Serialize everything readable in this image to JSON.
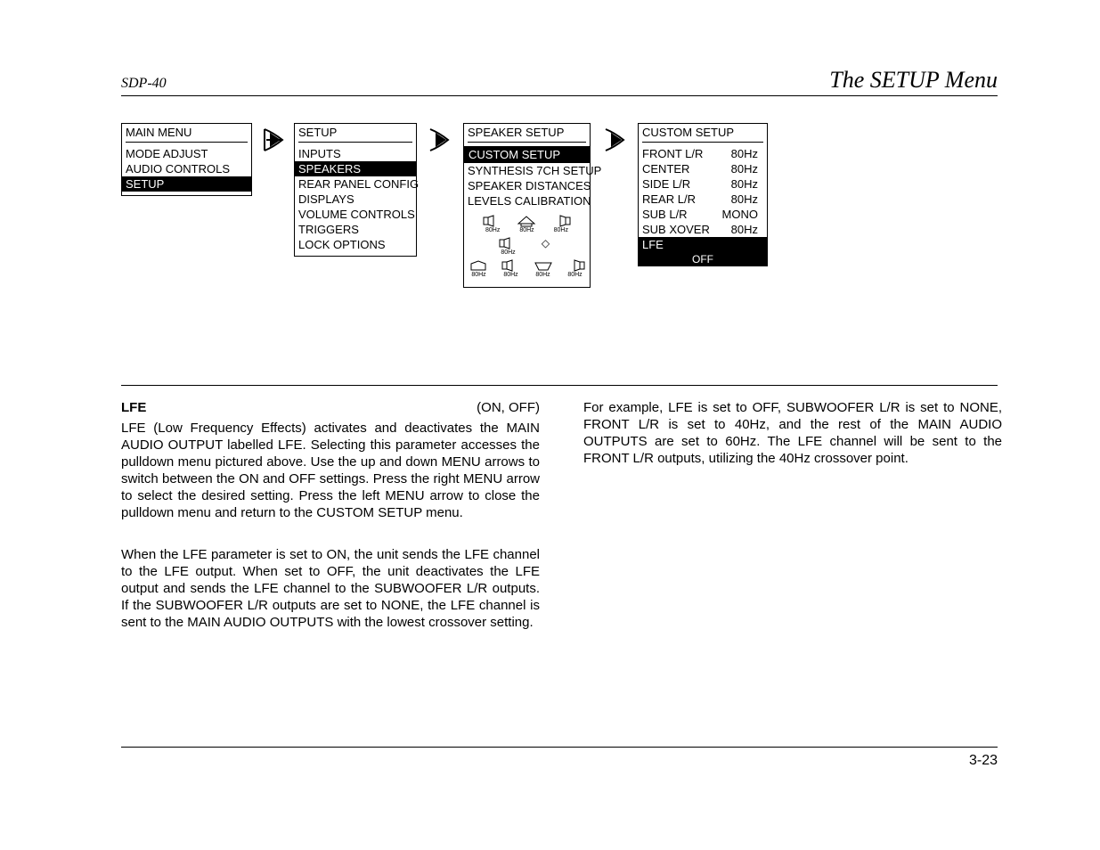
{
  "header": {
    "left": "SDP-40",
    "right": "The SETUP Menu"
  },
  "footer": {
    "page": "3-23"
  },
  "menus": {
    "main": {
      "title": "MAIN MENU",
      "items": [
        "MODE ADJUST",
        "AUDIO CONTROLS",
        "SETUP"
      ],
      "selected": 2
    },
    "setup": {
      "title": "SETUP",
      "items": [
        "INPUTS",
        "SPEAKERS",
        "REAR PANEL CONFIG",
        "DISPLAYS",
        "VOLUME CONTROLS",
        "TRIGGERS",
        "LOCK OPTIONS"
      ],
      "selected": 1
    },
    "speaker": {
      "title": "SPEAKER SETUP",
      "items": [
        "CUSTOM SETUP",
        "SYNTHESIS 7CH SETUP",
        "SPEAKER DISTANCES",
        "LEVELS CALIBRATION"
      ],
      "selected": 0,
      "diagram": {
        "row1": [
          {
            "label": "L",
            "sub": "80Hz"
          },
          {
            "label": "L/R",
            "sub": "80Hz"
          },
          {
            "label": "R",
            "sub": "80Hz"
          }
        ],
        "row2": [
          {
            "label": "C",
            "sub": "80Hz"
          },
          {
            "label": "◇",
            "sub": ""
          }
        ],
        "row3": [
          {
            "label": "SUB",
            "sub": "80Hz"
          },
          {
            "label": "L",
            "sub": "80Hz"
          },
          {
            "label": "L/R",
            "sub": "80Hz"
          },
          {
            "label": "R",
            "sub": "80Hz"
          }
        ]
      }
    },
    "custom": {
      "title": "CUSTOM SETUP",
      "items": [
        {
          "label": "FRONT L/R",
          "value": "80Hz"
        },
        {
          "label": "CENTER",
          "value": "80Hz"
        },
        {
          "label": "SIDE L/R",
          "value": "80Hz"
        },
        {
          "label": "REAR L/R",
          "value": "80Hz"
        },
        {
          "label": "SUB L/R",
          "value": "MONO"
        },
        {
          "label": "SUB XOVER",
          "value": "80Hz"
        }
      ],
      "selected_label": "LFE",
      "selected_value": "OFF"
    }
  },
  "body": {
    "term": "LFE",
    "term_opts": "(ON, OFF)",
    "p1": "LFE (Low Frequency Effects) activates and deactivates the MAIN AUDIO OUTPUT labelled LFE. Selecting this parameter accesses the pulldown menu pictured above. Use the up and down MENU arrows to switch between the ON and OFF settings. Press the right MENU arrow to select the desired setting. Press the left MENU arrow to close the pulldown menu and return to the CUSTOM SETUP menu.",
    "p2": "When the LFE parameter is set to ON, the unit sends the LFE channel to the LFE output. When set to OFF, the unit deactivates the LFE output and sends the LFE channel to the SUBWOOFER L/R outputs. If the SUBWOOFER L/R outputs are set to NONE, the LFE channel is sent to the MAIN AUDIO OUTPUTS with the lowest crossover setting.",
    "p3": "For example, LFE is set to OFF, SUBWOOFER L/R is set to NONE, FRONT L/R is set to 40Hz, and the rest of the MAIN AUDIO OUTPUTS are set to 60Hz.  The LFE channel will be sent to the FRONT L/R outputs, utilizing the 40Hz crossover point."
  }
}
